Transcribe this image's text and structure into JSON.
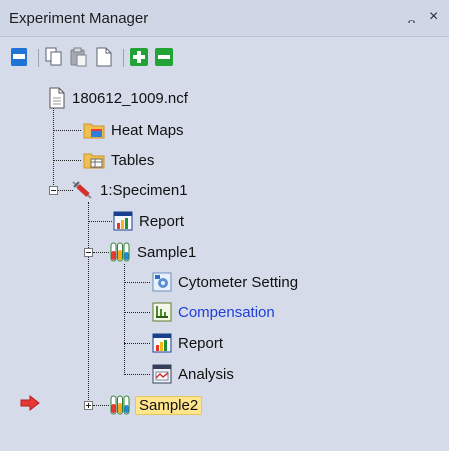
{
  "window": {
    "title": "Experiment Manager",
    "pin_glyph": "᎔",
    "close_glyph": "×"
  },
  "toolbar": {
    "buttons": [
      {
        "name": "view-panel-icon"
      },
      {
        "name": "copy-icon"
      },
      {
        "name": "paste-icon"
      },
      {
        "name": "document-icon"
      },
      {
        "name": "add-icon"
      },
      {
        "name": "remove-icon"
      }
    ]
  },
  "tree": {
    "file": "180612_1009.ncf",
    "heat_maps": "Heat Maps",
    "tables": "Tables",
    "specimen": "1:Specimen1",
    "specimen_report": "Report",
    "sample1": "Sample1",
    "cytometer_setting": "Cytometer Setting",
    "compensation": "Compensation",
    "sample1_report": "Report",
    "analysis": "Analysis",
    "sample2": "Sample2"
  },
  "state": {
    "selected_node": "Sample2",
    "pointer": "red-arrow-icon"
  },
  "colors": {
    "panel_bg": "#d6dbe9",
    "selection": "#ffe58c",
    "link_text": "#1f3fd6"
  }
}
